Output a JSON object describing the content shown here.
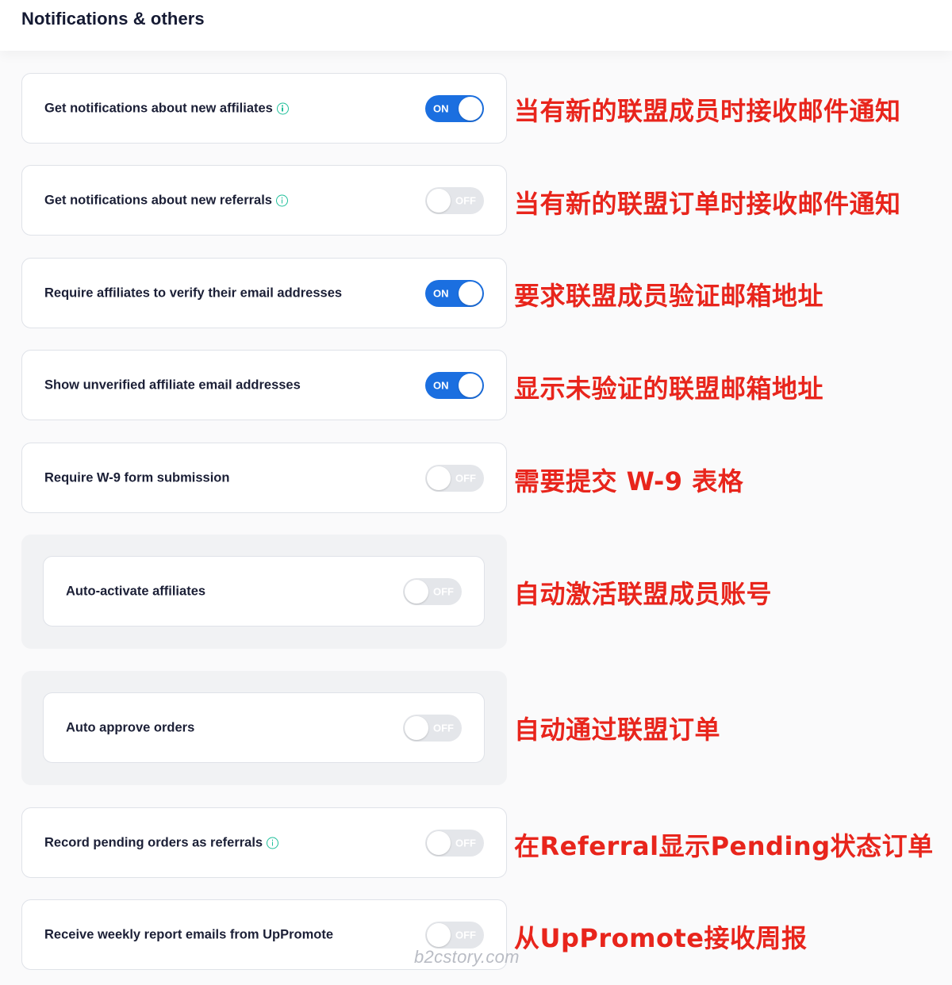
{
  "header": {
    "title": "Notifications & others"
  },
  "settings": [
    {
      "label": "Get notifications about new affiliates",
      "info": true,
      "state": "ON",
      "annotation": "当有新的联盟成员时接收邮件通知"
    },
    {
      "label": "Get notifications about new referrals",
      "info": true,
      "state": "OFF",
      "annotation": "当有新的联盟订单时接收邮件通知"
    },
    {
      "label": "Require affiliates to verify their email addresses",
      "info": false,
      "state": "ON",
      "annotation": "要求联盟成员验证邮箱地址"
    },
    {
      "label": "Show unverified affiliate email addresses",
      "info": false,
      "state": "ON",
      "annotation": "显示未验证的联盟邮箱地址"
    },
    {
      "label": "Require W-9 form submission",
      "info": false,
      "state": "OFF",
      "annotation": "需要提交 W-9 表格"
    },
    {
      "label": "Auto-activate affiliates",
      "info": false,
      "state": "OFF",
      "annotation": "自动激活联盟成员账号"
    },
    {
      "label": "Auto approve orders",
      "info": false,
      "state": "OFF",
      "annotation": "自动通过联盟订单"
    },
    {
      "label": "Record pending orders as referrals",
      "info": true,
      "state": "OFF",
      "annotation": "在Referral显示Pending状态订单"
    },
    {
      "label": "Receive weekly report emails from UpPromote",
      "info": false,
      "state": "OFF",
      "annotation": "从UpPromote接收周报"
    }
  ],
  "watermark": "b2cstory.com",
  "colors": {
    "toggle_on": "#1b6fe0",
    "toggle_off": "#e4e6ea",
    "annotation": "#e8251c",
    "info": "#1fbf9a"
  }
}
